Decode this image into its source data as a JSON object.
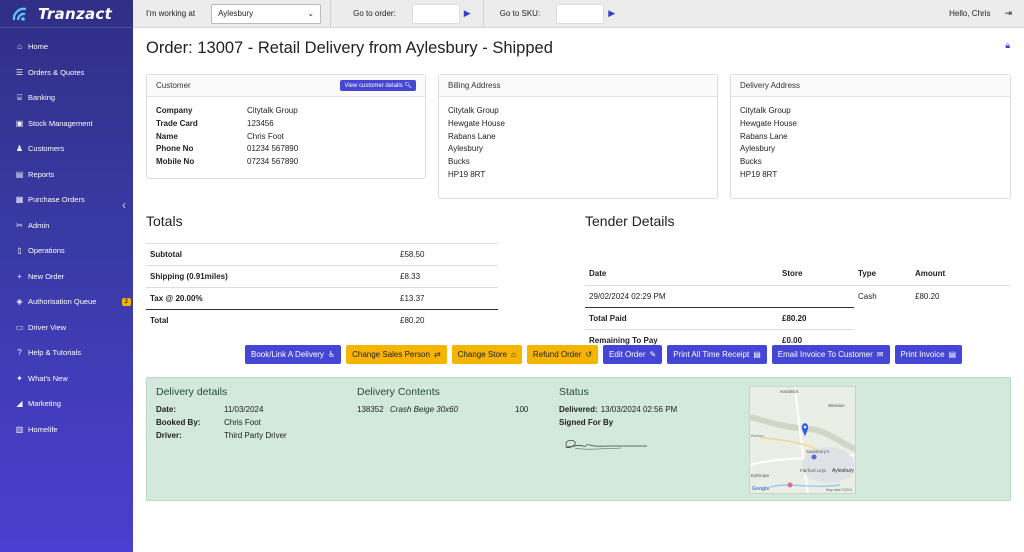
{
  "app": {
    "name": "Tranzact"
  },
  "colors": {
    "accent": "#4646d6",
    "warning": "#f5b400",
    "panel": "#d2e9dc",
    "sidebar": "#3a3aa6"
  },
  "sidebar": {
    "items": [
      {
        "label": "Home",
        "icon": "home-icon"
      },
      {
        "label": "Orders & Quotes",
        "icon": "list-icon"
      },
      {
        "label": "Banking",
        "icon": "bank-icon"
      },
      {
        "label": "Stock Management",
        "icon": "box-icon"
      },
      {
        "label": "Customers",
        "icon": "users-icon"
      },
      {
        "label": "Reports",
        "icon": "chart-icon"
      },
      {
        "label": "Purchase Orders",
        "icon": "cart-icon"
      },
      {
        "label": "Admin",
        "icon": "tools-icon"
      },
      {
        "label": "Operations",
        "icon": "clipboard-icon"
      },
      {
        "label": "New Order",
        "icon": "plus-icon"
      },
      {
        "label": "Authorisation Queue",
        "icon": "shield-icon",
        "badge": "2"
      },
      {
        "label": "Driver View",
        "icon": "truck-icon"
      },
      {
        "label": "Help & Tutorials",
        "icon": "help-icon"
      },
      {
        "label": "What's New",
        "icon": "sparkle-icon"
      },
      {
        "label": "Marketing",
        "icon": "megaphone-icon"
      },
      {
        "label": "Homelife",
        "icon": "book-icon"
      }
    ]
  },
  "topbar": {
    "working_label": "I'm working at",
    "location": "Aylesbury",
    "go_order_label": "Go to order:",
    "go_sku_label": "Go to SKU:",
    "greeting": "Hello, Chris"
  },
  "order": {
    "title": "Order: 13007 - Retail Delivery from Aylesbury - Shipped"
  },
  "customer": {
    "header": "Customer",
    "view_button": "View customer details",
    "fields": [
      {
        "key": "Company",
        "value": "Citytalk Group"
      },
      {
        "key": "Trade Card",
        "value": "123456"
      },
      {
        "key": "Name",
        "value": "Chris Foot"
      },
      {
        "key": "Phone No",
        "value": "01234 567890"
      },
      {
        "key": "Mobile No",
        "value": "07234 567890"
      }
    ]
  },
  "billing": {
    "header": "Billing Address",
    "lines": [
      "Citytalk Group",
      "Hewgate House",
      "Rabans Lane",
      "Aylesbury",
      "Bucks",
      "HP19 8RT"
    ]
  },
  "delivery_address": {
    "header": "Delivery Address",
    "lines": [
      "Citytalk Group",
      "Hewgate House",
      "Rabans Lane",
      "Aylesbury",
      "Bucks",
      "HP19 8RT"
    ]
  },
  "totals": {
    "title": "Totals",
    "rows": [
      {
        "label": "Subtotal",
        "value": "£58.50"
      },
      {
        "label": "Shipping (0.91miles)",
        "value": "£8.33"
      },
      {
        "label": "Tax @ 20.00%",
        "value": "£13.37"
      },
      {
        "label": "Total",
        "value": "£80.20"
      }
    ]
  },
  "tender": {
    "title": "Tender Details",
    "headers": [
      "Date",
      "Store",
      "Type",
      "Amount"
    ],
    "row": {
      "date": "29/02/2024 02:29 PM",
      "store": "",
      "type": "Cash",
      "amount": "£80.20"
    },
    "total_paid_label": "Total Paid",
    "total_paid": "£80.20",
    "remaining_label": "Remaining To Pay",
    "remaining": "£0.00"
  },
  "actions": [
    {
      "label": "Book/Link A Delivery",
      "style": "blue",
      "icon": "person-icon"
    },
    {
      "label": "Change Sales Person",
      "style": "yellow",
      "icon": "swap-person-icon"
    },
    {
      "label": "Change Store",
      "style": "yellow",
      "icon": "store-icon"
    },
    {
      "label": "Refund Order",
      "style": "yellow",
      "icon": "undo-icon"
    },
    {
      "label": "Edit Order",
      "style": "blue",
      "icon": "pencil-icon"
    },
    {
      "label": "Print All Time Receipt",
      "style": "blue",
      "icon": "document-icon"
    },
    {
      "label": "Email Invoice To Customer",
      "style": "blue",
      "icon": "envelope-icon"
    },
    {
      "label": "Print Invoice",
      "style": "blue",
      "icon": "document-icon"
    }
  ],
  "delivery": {
    "details_title": "Delivery details",
    "date_label": "Date:",
    "date": "11/03/2024",
    "booked_label": "Booked By:",
    "booked_by": "Chris Foot",
    "driver_label": "Driver:",
    "driver": "Third Party Driver",
    "contents_title": "Delivery Contents",
    "item_code": "138352",
    "item_name": "Crash Beige 30x60",
    "item_qty": "100",
    "status_title": "Status",
    "delivered_label": "Delivered:",
    "delivered": "13/03/2024 02:56 PM",
    "signed_label": "Signed For By"
  },
  "map": {
    "labels": [
      "Hardwick",
      "Weedon",
      "Sainsbury's",
      "Fairford Leys",
      "Aylesbury",
      "Eythrope",
      "Bierton",
      "Google",
      "Map data ©2024"
    ]
  }
}
